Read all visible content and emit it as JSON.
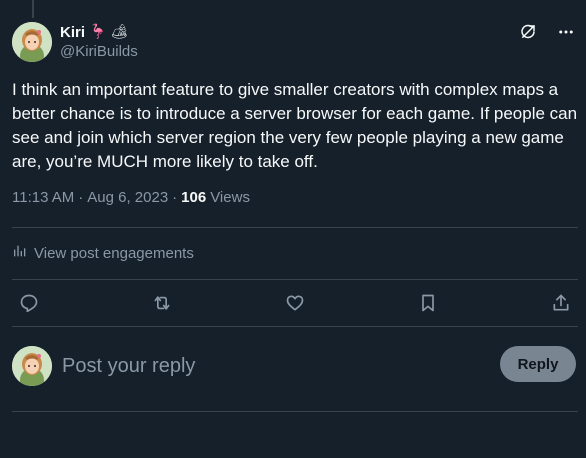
{
  "author": {
    "display_name": "Kiri",
    "handle": "@KiriBuilds",
    "emojis": [
      "🦩",
      "🏕"
    ]
  },
  "post": {
    "text": "I think an important feature to give smaller creators with complex maps a better chance is to introduce a server browser for each game. If people can see and join which server region the very few people playing a new game are, you’re MUCH more likely to take off.",
    "time": "11:13 AM",
    "separator": "·",
    "date": "Aug 6, 2023",
    "separator2": "·",
    "views_count": "106",
    "views_label": "Views"
  },
  "engagements": {
    "label": "View post engagements",
    "icon": "analytics-icon"
  },
  "actions": {
    "icons": [
      "reply-icon",
      "repost-icon",
      "like-icon",
      "bookmark-icon",
      "share-icon"
    ]
  },
  "header_icons": [
    "grok-icon",
    "more-icon"
  ],
  "reply": {
    "placeholder": "Post your reply",
    "button_label": "Reply"
  },
  "colors": {
    "background": "#15202b",
    "text": "#f7f9f9",
    "secondary": "#8b98a5",
    "divider": "#38444d"
  }
}
